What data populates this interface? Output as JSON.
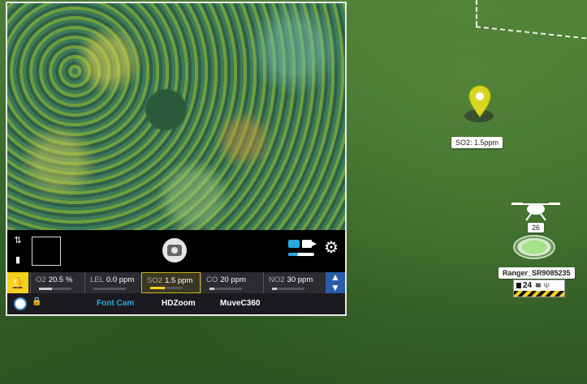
{
  "map": {
    "pin": {
      "icon": "location-pin-icon",
      "color": "#d9d620",
      "label": "SO2: 1.5ppm"
    },
    "drone": {
      "icon": "drone-icon",
      "altitude": "26",
      "name": "Ranger_SR9085235",
      "battery": "24",
      "status_icons": [
        "battery-icon",
        "wifi-icon",
        "signal-icon"
      ]
    }
  },
  "camera_panel": {
    "controls": {
      "side_icons": [
        "sliders-icon",
        "bookmark-icon"
      ],
      "shutter_icon": "camera-shutter-icon",
      "mode_icons": [
        "photo-mode-icon",
        "video-mode-icon"
      ],
      "settings_icon": "gear-icon"
    },
    "sensors": [
      {
        "name": "O2",
        "value": "20.5 %",
        "level": 0.4,
        "active": false
      },
      {
        "name": "LEL",
        "value": "0.0 ppm",
        "level": 0.0,
        "active": false
      },
      {
        "name": "SO2",
        "value": "1.5 ppm",
        "level": 0.45,
        "active": true
      },
      {
        "name": "CO",
        "value": "20 ppm",
        "level": 0.15,
        "active": false
      },
      {
        "name": "NO2",
        "value": "30 ppm",
        "level": 0.15,
        "active": false
      }
    ],
    "cameras": [
      {
        "label": "Font Cam",
        "active": true
      },
      {
        "label": "HDZoom",
        "active": false
      },
      {
        "label": "MuveC360",
        "active": false
      }
    ],
    "accent": "#25a8e0",
    "alert_color": "#f4d21b"
  }
}
